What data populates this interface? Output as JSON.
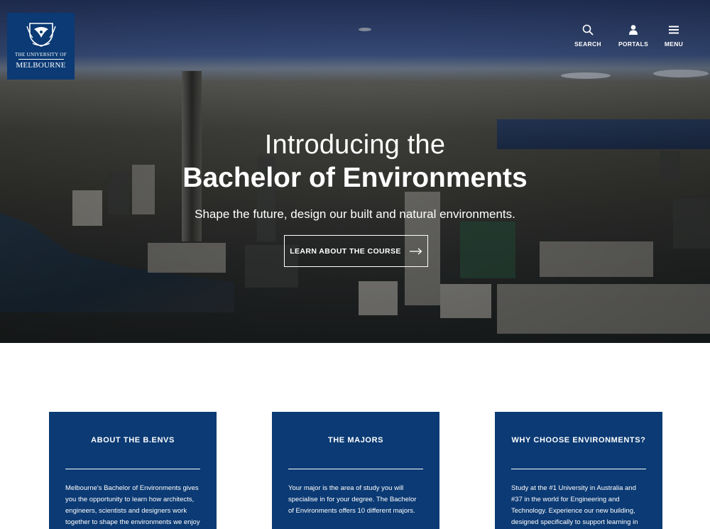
{
  "logo": {
    "line1": "THE UNIVERSITY OF",
    "line2": "MELBOURNE"
  },
  "nav": {
    "search": {
      "label": "SEARCH",
      "icon": "search-icon"
    },
    "portals": {
      "label": "PORTALS",
      "icon": "user-icon"
    },
    "menu": {
      "label": "MENU",
      "icon": "hamburger-icon"
    }
  },
  "hero": {
    "intro": "Introducing the",
    "headline": "Bachelor of Environments",
    "subtitle": "Shape the future, design our built and natural environments.",
    "cta_label": "LEARN ABOUT THE COURSE"
  },
  "cards": [
    {
      "title": "ABOUT THE B.ENVS",
      "body": "Melbourne's Bachelor of Environments gives you the opportunity to learn how architects, engineers, scientists and designers work together to shape the environments we enjoy"
    },
    {
      "title": "THE MAJORS",
      "body": "Your major is the area of study you will specialise in for your degree. The Bachelor of Environments offers 10 different majors."
    },
    {
      "title": "WHY CHOOSE ENVIRONMENTS?",
      "body": "Study at the #1 University in Australia and #37 in the world for Engineering and Technology. Experience our new building, designed specifically to support learning in the built"
    }
  ],
  "colors": {
    "brand_navy": "#0b3a74",
    "text_on_dark": "#ffffff"
  }
}
